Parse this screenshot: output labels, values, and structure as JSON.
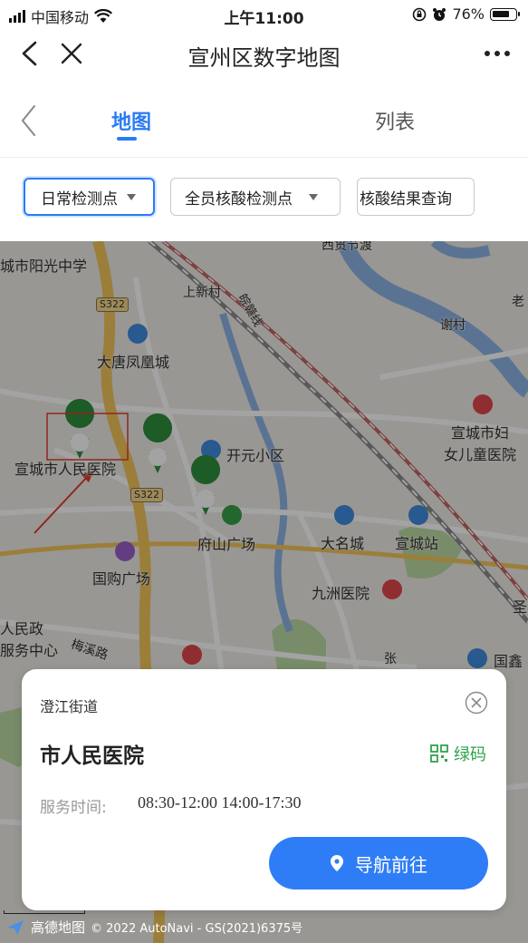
{
  "status_bar": {
    "carrier": "中国移动",
    "time": "上午11:00",
    "battery": "76%"
  },
  "nav": {
    "title": "宣州区数字地图"
  },
  "tabs": {
    "map": "地图",
    "list": "列表",
    "active": "地图"
  },
  "filters": {
    "daily": "日常检测点",
    "all_staff": "全员核酸检测点",
    "result_query": "核酸结果查询"
  },
  "map": {
    "labels": {
      "yangguang": "城市阳光中学",
      "xigui": "西贯节渡",
      "shangxincun": "上新村",
      "xiecun": "谢村",
      "lao": "老",
      "datang": "大唐凤凰城",
      "maternal": "宣城市妇",
      "maternal2": "女儿童医院",
      "kaiyuan": "开元小区",
      "hospital": "宣城市人民医院",
      "fushan": "府山广场",
      "daming": "大名城",
      "station": "宣城站",
      "guogou": "国购广场",
      "jiuzhou": "九洲医院",
      "sheng": "圣",
      "renmin1": "人民政",
      "renmin2": "服务中心",
      "meixi": "梅溪路",
      "zhang": "张",
      "guoxin": "国鑫"
    },
    "road_tags": [
      "S322",
      "S322"
    ],
    "rail_label": "皖赣线"
  },
  "card": {
    "street": "澄江街道",
    "name": "市人民医院",
    "code_label": "绿码",
    "hours_label": "服务时间:",
    "hours": "08:30-12:00 14:00-17:30",
    "nav_button": "导航前往"
  },
  "attribution": {
    "brand": "高德地图",
    "copyright": "© 2022 AutoNavi - GS(2021)6375号"
  },
  "colors": {
    "accent": "#2a7bf6",
    "green_code": "#2fa34f",
    "marker_green": "#2e8f3e",
    "highlight_box": "#e03a2f"
  }
}
